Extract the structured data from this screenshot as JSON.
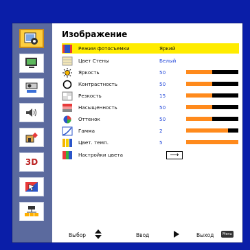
{
  "menu_title": "Изображение",
  "sidebar": {
    "items": [
      {
        "name": "image-menu",
        "icon": "picture-icon",
        "active": true
      },
      {
        "name": "display-menu",
        "icon": "monitor-icon",
        "active": false
      },
      {
        "name": "setup-menu",
        "icon": "projector-icon",
        "active": false
      },
      {
        "name": "audio-menu",
        "icon": "speaker-icon",
        "active": false
      },
      {
        "name": "options-menu",
        "icon": "options-icon",
        "active": false
      },
      {
        "name": "3d-menu",
        "icon": "3d-icon",
        "label": "3D",
        "active": false
      },
      {
        "name": "network-menu",
        "icon": "network-icon",
        "active": false
      },
      {
        "name": "lan-menu",
        "icon": "lan-icon",
        "active": false
      }
    ]
  },
  "rows": [
    {
      "label": "Режим фотосъемки",
      "value": "Яркий"
    },
    {
      "label": "Цвет Стены",
      "value": "Белый"
    },
    {
      "label": "Яркость",
      "value": "50",
      "level": 0.5
    },
    {
      "label": "Контрастность",
      "value": "50",
      "level": 0.5
    },
    {
      "label": "Резкость",
      "value": "15",
      "level": 0.5
    },
    {
      "label": "Насыщенность",
      "value": "50",
      "level": 0.5
    },
    {
      "label": "Оттенок",
      "value": "50",
      "level": 0.5
    },
    {
      "label": "Гамма",
      "value": "2",
      "level": 0.8
    },
    {
      "label": "Цвет. темп.",
      "value": "5",
      "level": 1.0
    },
    {
      "label": "Настройки цвета",
      "value": ""
    }
  ],
  "enter_glyph": "⟶",
  "footer": {
    "select_label": "Выбор",
    "enter_label": "Ввод",
    "exit_label": "Выход",
    "menu_key": "Menu"
  },
  "colors": {
    "background": "#0a1ea8",
    "highlight": "#ffec00",
    "bar_fill": "#ff8a1c",
    "value_text": "#1d43d8"
  }
}
